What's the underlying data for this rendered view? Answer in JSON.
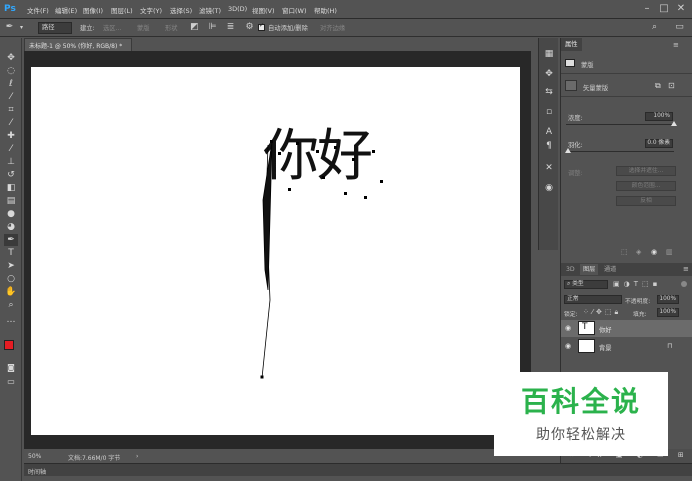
{
  "app": {
    "logo": "Ps"
  },
  "menubar": {
    "items": [
      "文件(F)",
      "编辑(E)",
      "图像(I)",
      "图层(L)",
      "文字(Y)",
      "选择(S)",
      "滤镜(T)",
      "3D(D)",
      "视图(V)",
      "窗口(W)",
      "帮助(H)"
    ],
    "window_controls": [
      "minimize-icon",
      "maximize-icon",
      "close-icon"
    ]
  },
  "options": {
    "tool_icon": "pen-icon",
    "mode_value": "路径",
    "make_label": "建立:",
    "selection_label": "选区...",
    "mask_label": "蒙版",
    "shape_label": "形状",
    "auto_add_delete_label": "自动添加/删除",
    "auto_add_delete_checked": true,
    "align_edges_label": "对齐边缘"
  },
  "document": {
    "tab_title": "未标题-1 @ 50% (你好, RGB/8) *",
    "canvas_text": "你好",
    "zoom": "50%",
    "doc_size": "文档:7.66M/0 字节"
  },
  "timeline": {
    "label": "时间轴"
  },
  "properties": {
    "tab_label": "属性",
    "mask_header": "蒙版",
    "vector_mask_label": "矢量蒙版",
    "density_label": "浓度:",
    "density_value": "100%",
    "density_fraction": 1.0,
    "feather_label": "羽化:",
    "feather_value": "0.0 像素",
    "feather_fraction": 0.0,
    "adjust_label": "调整:",
    "select_and_mask": "选择并遮住...",
    "color_range": "颜色范围...",
    "invert": "反相"
  },
  "layers": {
    "tabs": [
      "3D",
      "图层",
      "通道"
    ],
    "active_tab": "图层",
    "filter_kind": "类型",
    "blend_mode": "正常",
    "opacity_label": "不透明度:",
    "opacity_value": "100%",
    "lock_label": "锁定:",
    "fill_label": "填充:",
    "fill_value": "100%",
    "items": [
      {
        "name": "你好",
        "visible": true,
        "locked": false
      },
      {
        "name": "背景",
        "visible": true,
        "locked": true
      }
    ]
  },
  "watermark": {
    "title": "百科全说",
    "subtitle": "助你轻松解决",
    "title_color": "#2bb24c"
  },
  "colors": {
    "foreground": "#e51c23",
    "background": "#ffffff",
    "accent": "#31a8ff"
  }
}
